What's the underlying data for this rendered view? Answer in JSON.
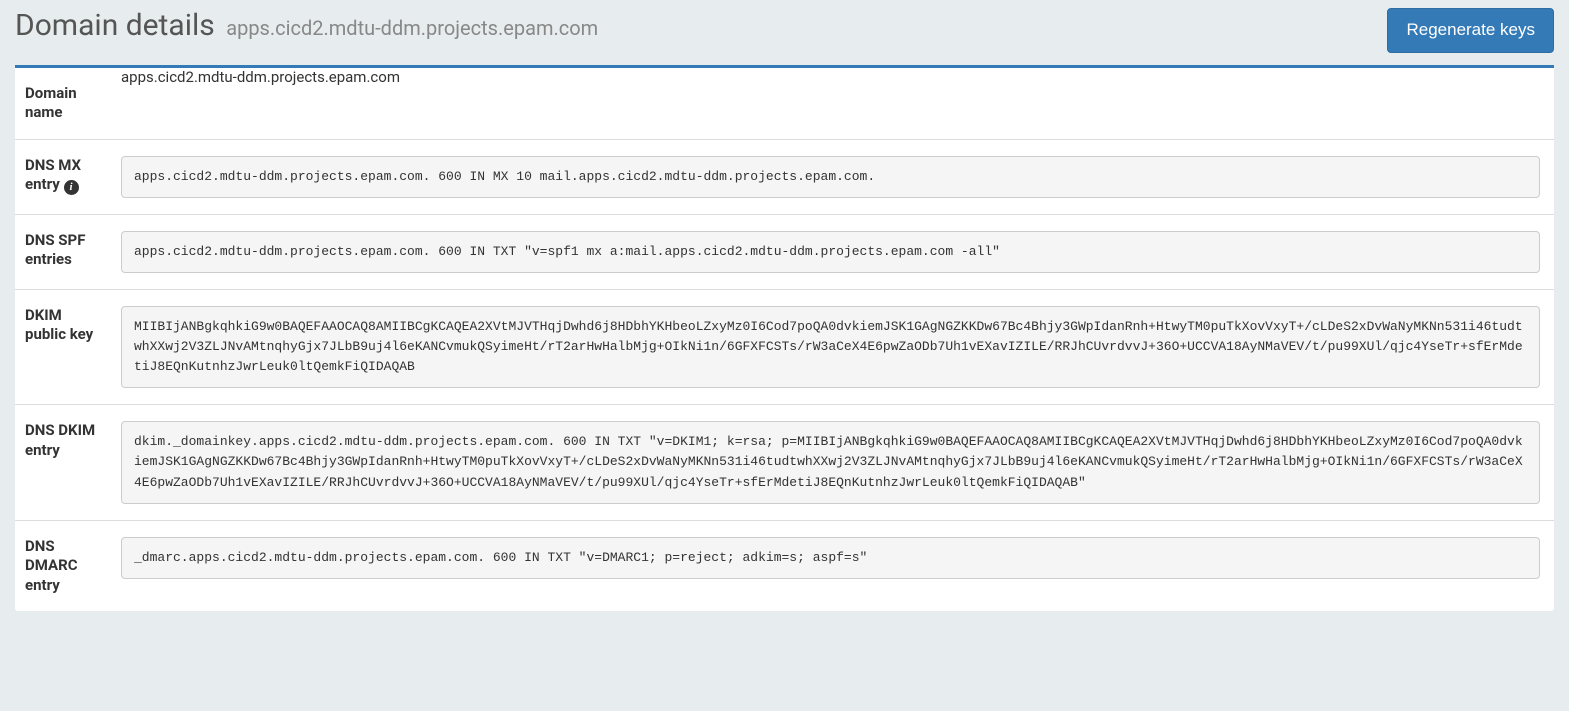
{
  "header": {
    "title": "Domain details",
    "subtitle": "apps.cicd2.mdtu-ddm.projects.epam.com",
    "regenerate_label": "Regenerate keys"
  },
  "rows": {
    "domain_name": {
      "label": "Domain name",
      "value": "apps.cicd2.mdtu-ddm.projects.epam.com"
    },
    "dns_mx": {
      "label": "DNS MX entry",
      "info_icon": "i",
      "value": "apps.cicd2.mdtu-ddm.projects.epam.com. 600 IN MX 10 mail.apps.cicd2.mdtu-ddm.projects.epam.com."
    },
    "dns_spf": {
      "label": "DNS SPF entries",
      "value": "apps.cicd2.mdtu-ddm.projects.epam.com. 600 IN TXT \"v=spf1 mx a:mail.apps.cicd2.mdtu-ddm.projects.epam.com -all\""
    },
    "dkim_key": {
      "label": "DKIM public key",
      "value": "MIIBIjANBgkqhkiG9w0BAQEFAAOCAQ8AMIIBCgKCAQEA2XVtMJVTHqjDwhd6j8HDbhYKHbeoLZxyMz0I6Cod7poQA0dvkiemJSK1GAgNGZKKDw67Bc4Bhjy3GWpIdanRnh+HtwyTM0puTkXovVxyT+/cLDeS2xDvWaNyMKNn531i46tudtwhXXwj2V3ZLJNvAMtnqhyGjx7JLbB9uj4l6eKANCvmukQSyimeHt/rT2arHwHalbMjg+OIkNi1n/6GFXFCSTs/rW3aCeX4E6pwZaODb7Uh1vEXavIZILE/RRJhCUvrdvvJ+36O+UCCVA18AyNMaVEV/t/pu99XUl/qjc4YseTr+sfErMdetiJ8EQnKutnhzJwrLeuk0ltQemkFiQIDAQAB"
    },
    "dns_dkim": {
      "label": "DNS DKIM entry",
      "value": "dkim._domainkey.apps.cicd2.mdtu-ddm.projects.epam.com. 600 IN TXT \"v=DKIM1; k=rsa; p=MIIBIjANBgkqhkiG9w0BAQEFAAOCAQ8AMIIBCgKCAQEA2XVtMJVTHqjDwhd6j8HDbhYKHbeoLZxyMz0I6Cod7poQA0dvkiemJSK1GAgNGZKKDw67Bc4Bhjy3GWpIdanRnh+HtwyTM0puTkXovVxyT+/cLDeS2xDvWaNyMKNn531i46tudtwhXXwj2V3ZLJNvAMtnqhyGjx7JLbB9uj4l6eKANCvmukQSyimeHt/rT2arHwHalbMjg+OIkNi1n/6GFXFCSTs/rW3aCeX4E6pwZaODb7Uh1vEXavIZILE/RRJhCUvrdvvJ+36O+UCCVA18AyNMaVEV/t/pu99XUl/qjc4YseTr+sfErMdetiJ8EQnKutnhzJwrLeuk0ltQemkFiQIDAQAB\""
    },
    "dns_dmarc": {
      "label": "DNS DMARC entry",
      "value": "_dmarc.apps.cicd2.mdtu-ddm.projects.epam.com. 600 IN TXT \"v=DMARC1; p=reject; adkim=s; aspf=s\""
    }
  }
}
